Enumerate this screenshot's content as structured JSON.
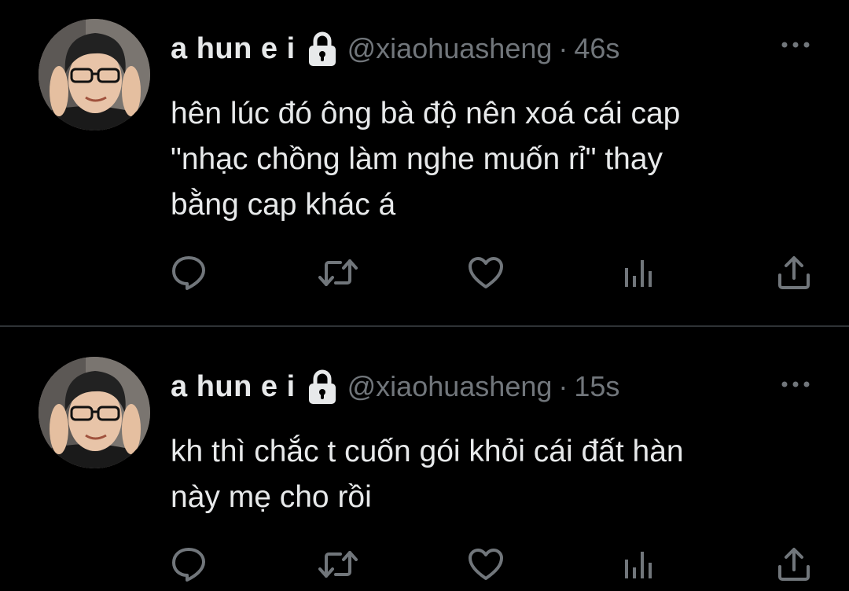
{
  "colors": {
    "background": "#000000",
    "text_primary": "#e7e9ea",
    "text_secondary": "#71767b",
    "divider": "#2f3336"
  },
  "tweets": [
    {
      "author": {
        "display_name": "a hun e i",
        "handle": "@xiaohuasheng",
        "protected_icon": "lock-icon",
        "avatar": "avatar"
      },
      "separator": "·",
      "time": "46s",
      "text_lines": [
        "hên lúc đó ông bà độ nên xoá cái cap",
        "\"nhạc chồng làm nghe muốn rỉ\" thay",
        "bằng cap khác á"
      ],
      "actions": [
        "reply-icon",
        "retweet-icon",
        "like-icon",
        "analytics-icon",
        "share-icon"
      ],
      "more_icon": "more-icon"
    },
    {
      "author": {
        "display_name": "a hun e i",
        "handle": "@xiaohuasheng",
        "protected_icon": "lock-icon",
        "avatar": "avatar"
      },
      "separator": "·",
      "time": "15s",
      "text_lines": [
        "kh thì chắc t cuốn gói khỏi cái đất hàn",
        "này mẹ cho rồi"
      ],
      "actions": [
        "reply-icon",
        "retweet-icon",
        "like-icon",
        "analytics-icon",
        "share-icon"
      ],
      "more_icon": "more-icon"
    }
  ]
}
